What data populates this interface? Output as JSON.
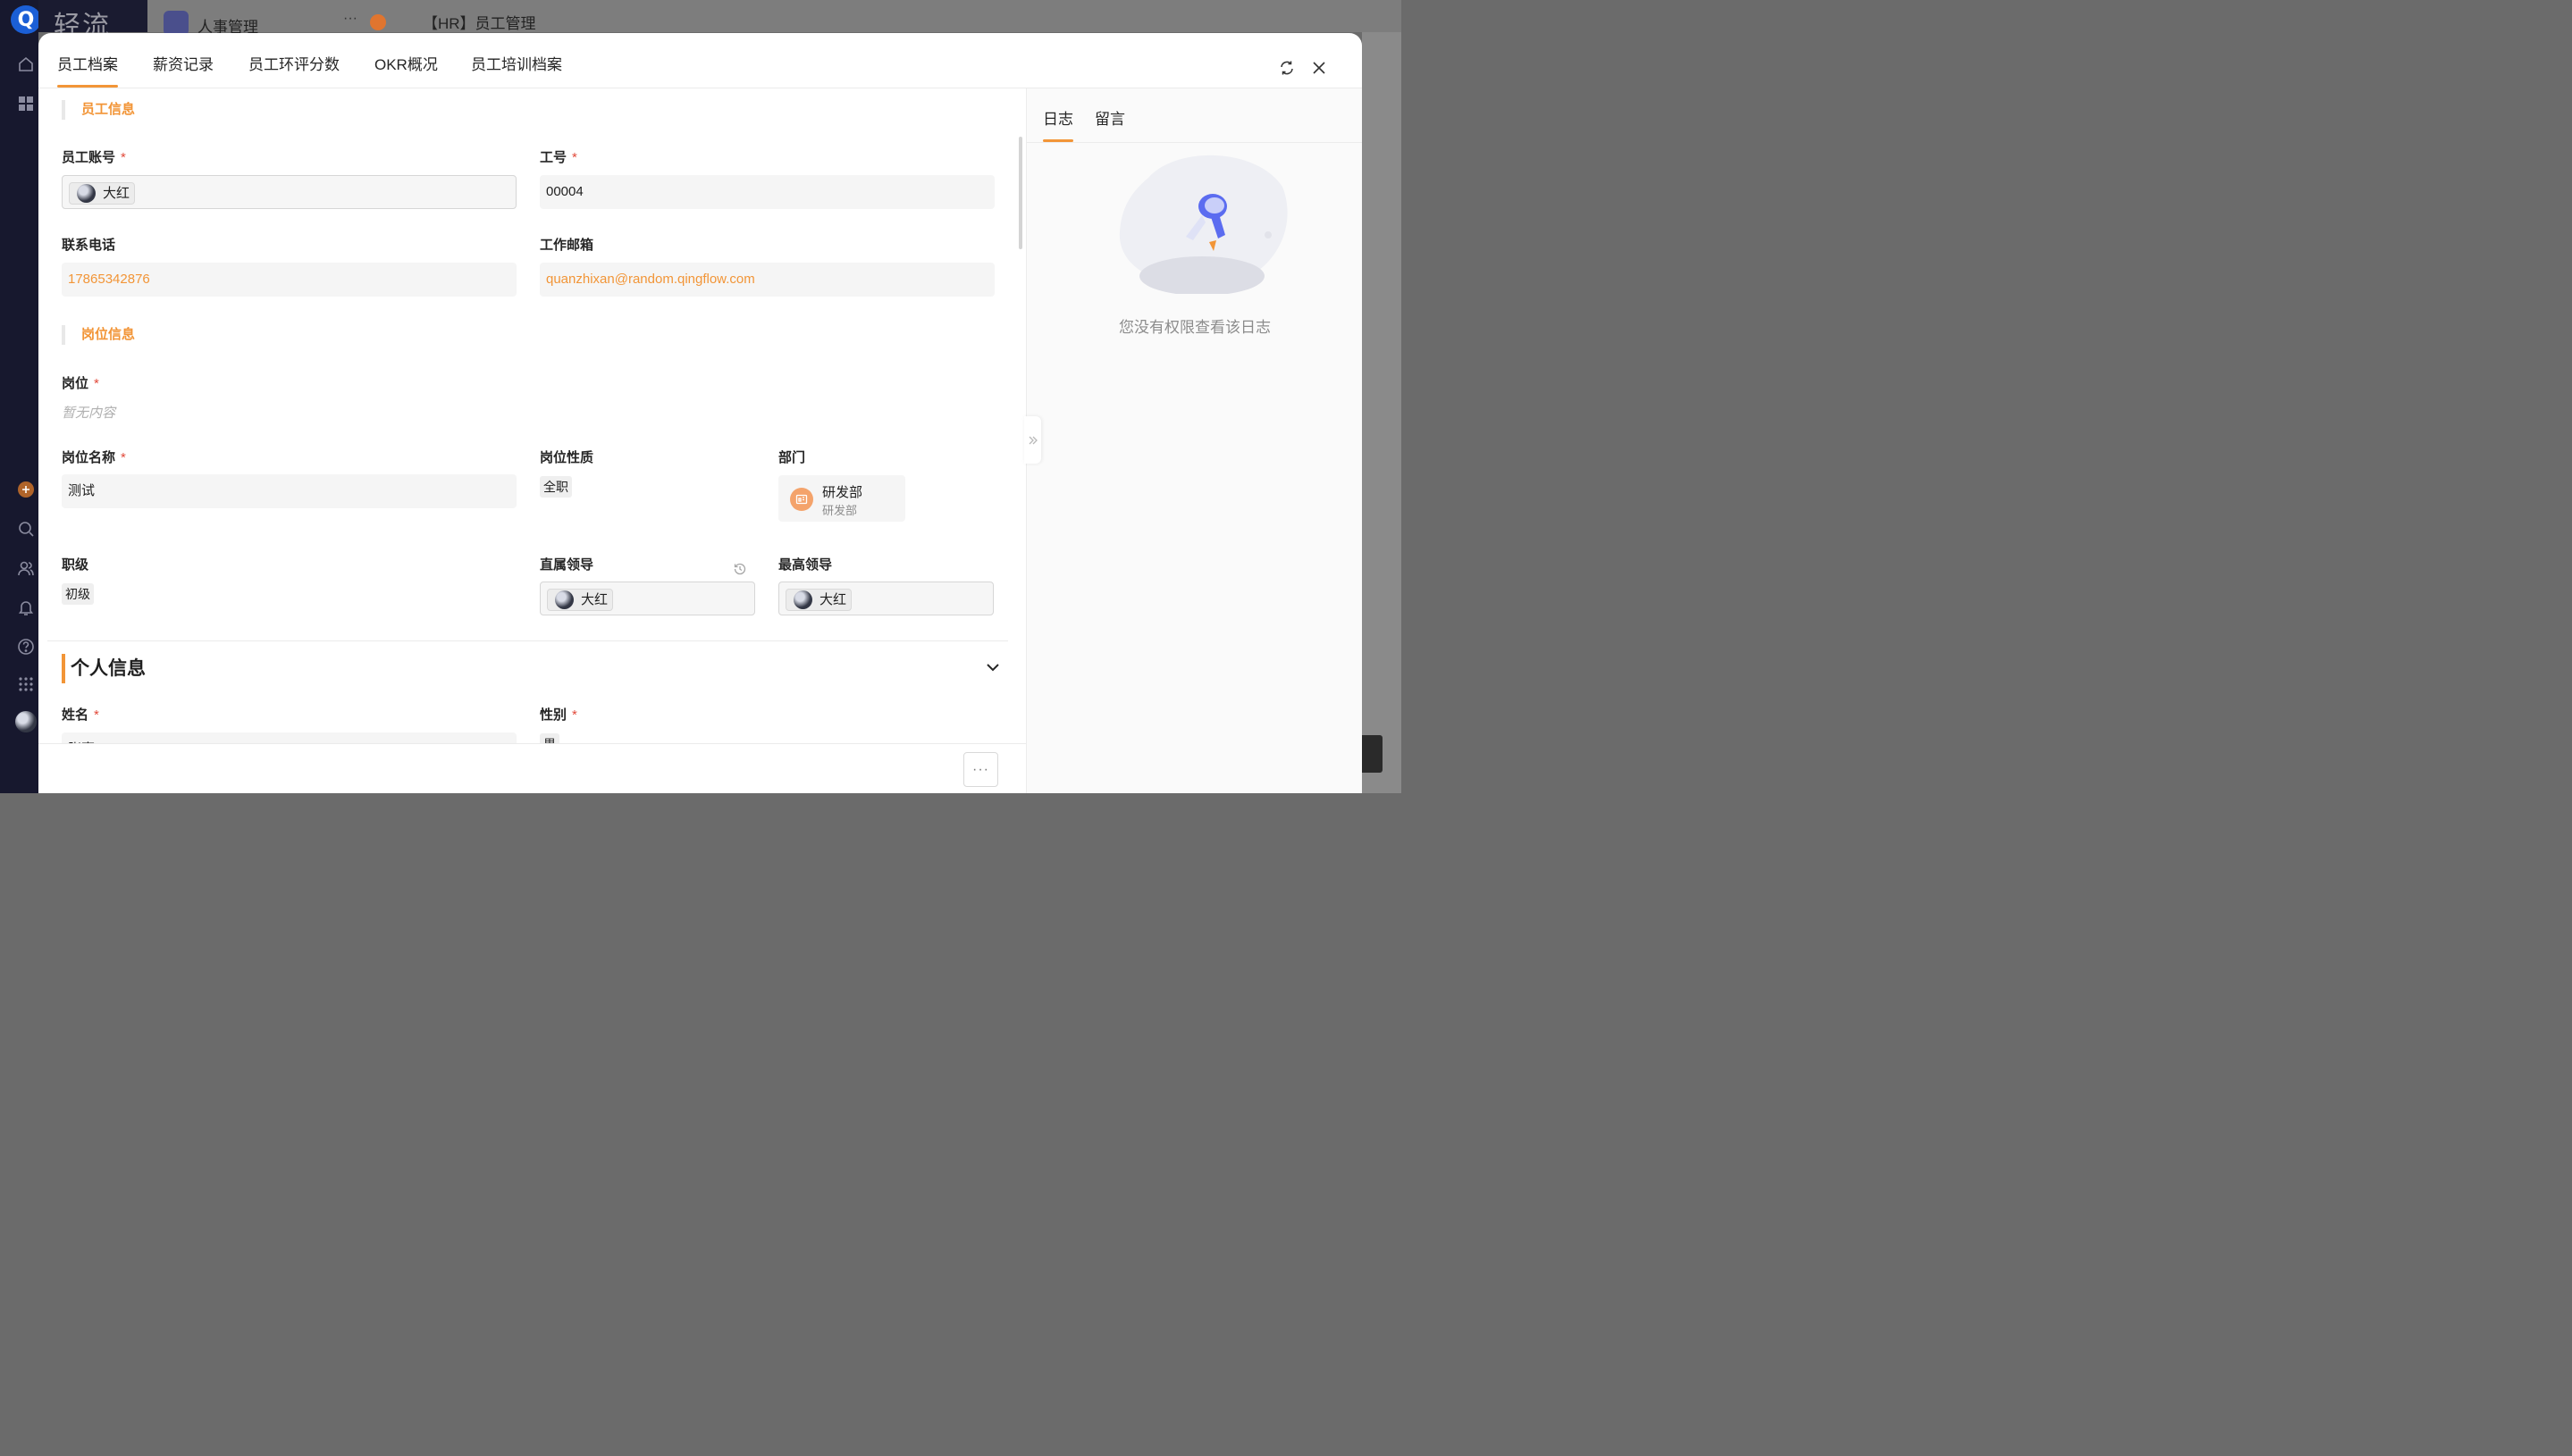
{
  "background": {
    "logo_text": "轻流",
    "app_title": "人事管理",
    "page_title": "【HR】员工管理",
    "more_dots": "···"
  },
  "tabs": [
    {
      "label": "员工档案",
      "active": true
    },
    {
      "label": "薪资记录"
    },
    {
      "label": "员工环评分数"
    },
    {
      "label": "OKR概况"
    },
    {
      "label": "员工培训档案"
    }
  ],
  "employee_info": {
    "section_title": "员工信息",
    "account": {
      "label": "员工账号",
      "value": "大红"
    },
    "employee_no": {
      "label": "工号",
      "value": "00004"
    },
    "phone": {
      "label": "联系电话",
      "value": "17865342876"
    },
    "email": {
      "label": "工作邮箱",
      "value": "quanzhixan@random.qingflow.com"
    }
  },
  "position_info": {
    "section_title": "岗位信息",
    "position": {
      "label": "岗位",
      "value": "暂无内容"
    },
    "position_name": {
      "label": "岗位名称",
      "value": "测试"
    },
    "position_type": {
      "label": "岗位性质",
      "value": "全职"
    },
    "department": {
      "label": "部门",
      "name": "研发部",
      "sub": "研发部"
    },
    "level": {
      "label": "职级",
      "value": "初级"
    },
    "direct_leader": {
      "label": "直属领导",
      "value": "大红"
    },
    "top_leader": {
      "label": "最高领导",
      "value": "大红"
    }
  },
  "personal_info": {
    "section_title": "个人信息",
    "name": {
      "label": "姓名",
      "value": "张嘉"
    },
    "gender": {
      "label": "性别",
      "value": "男"
    }
  },
  "required_mark": "*",
  "bottom": {
    "more_label": "···"
  },
  "side_panel": {
    "tabs": [
      {
        "label": "日志",
        "active": true
      },
      {
        "label": "留言"
      }
    ],
    "empty_message": "您没有权限查看该日志"
  },
  "colors": {
    "accent": "#f29537",
    "required": "#e24a3b"
  }
}
